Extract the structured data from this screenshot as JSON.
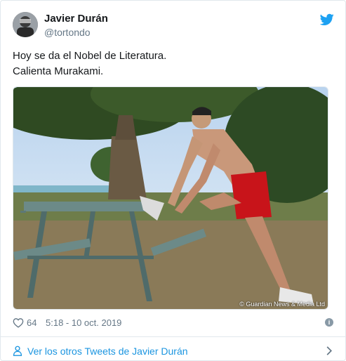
{
  "author": {
    "name": "Javier Durán",
    "handle": "@tortondo"
  },
  "tweet": {
    "lines": [
      "Hoy se da el Nobel de Literatura.",
      "Calienta Murakami."
    ]
  },
  "media": {
    "credit": "© Guardian News & Media Ltd"
  },
  "meta": {
    "likes": "64",
    "timestamp": "5:18 - 10 oct. 2019"
  },
  "footer": {
    "more_label": "Ver los otros Tweets de Javier Durán"
  },
  "icons": {
    "brand": "twitter-bird-icon",
    "like": "heart-icon",
    "info": "info-icon",
    "profile": "person-icon",
    "next": "chevron-right-icon"
  },
  "colors": {
    "accent": "#1b95e0",
    "secondary_text": "#657786",
    "border": "#e1e8ed"
  }
}
